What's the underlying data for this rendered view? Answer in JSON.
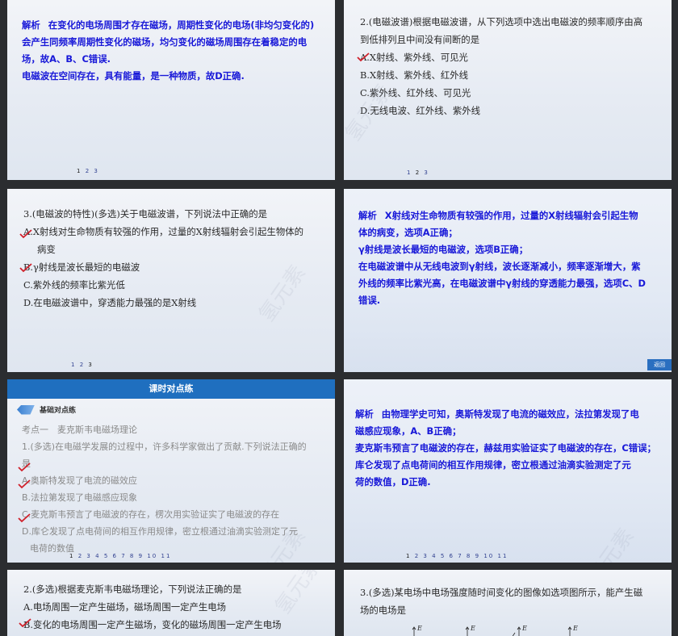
{
  "watermark": "氢元素",
  "slide1": {
    "tag": "解析",
    "lines": [
      "在变化的电场周围才存在磁场，周期性变化的电场(非均匀变化的)",
      "会产生同频率周期性变化的磁场，均匀变化的磁场周围存在着稳定的电",
      "场，故A、B、C错误.",
      "电磁波在空间存在，具有能量，是一种物质，故D正确."
    ],
    "pager": [
      "1",
      "2",
      "3"
    ],
    "pager_current": "1"
  },
  "slide2": {
    "stem": [
      "2.(电磁波谱)根据电磁波谱，从下列选项中选出电磁波的频率顺序由高",
      "到低排列且中间没有间断的是"
    ],
    "options": [
      "A.X射线、紫外线、可见光",
      "B.X射线、紫外线、红外线",
      "C.紫外线、红外线、可见光",
      "D.无线电波、红外线、紫外线"
    ],
    "pager": [
      "1",
      "2",
      "3"
    ],
    "pager_current": "2"
  },
  "slide3": {
    "stem": "3.(电磁波的特性)(多选)关于电磁波谱，下列说法中正确的是",
    "options": [
      "A.X射线对生命物质有较强的作用，过量的X射线辐射会引起生物体的",
      "病变",
      "B.γ射线是波长最短的电磁波",
      "C.紫外线的频率比紫光低",
      "D.在电磁波谱中，穿透能力最强的是X射线"
    ],
    "pager": [
      "1",
      "2",
      "3"
    ],
    "pager_current": "3"
  },
  "slide4": {
    "tag": "解析",
    "lines": [
      "X射线对生命物质有较强的作用，过量的X射线辐射会引起生物",
      "体的病变，选项A正确；",
      "γ射线是波长最短的电磁波，选项B正确；",
      "在电磁波谱中从无线电波到γ射线，波长逐渐减小，频率逐渐增大，紫",
      "外线的频率比紫光高，在电磁波谱中γ射线的穿透能力最强，选项C、D",
      "错误."
    ],
    "back_label": "返回"
  },
  "slide5": {
    "header": "课时对点练",
    "section": "基础对点练",
    "topic": "考点一　麦克斯韦电磁场理论",
    "stem": [
      "1.(多选)在电磁学发展的过程中，许多科学家做出了贡献.下列说法正确的",
      "是"
    ],
    "options": [
      "A.奥斯特发现了电流的磁效应",
      "B.法拉第发现了电磁感应现象",
      "C.麦克斯韦预言了电磁波的存在，楞次用实验证实了电磁波的存在",
      "D.库仑发现了点电荷间的相互作用规律，密立根通过油滴实验测定了元",
      "电荷的数值"
    ],
    "pager": [
      "1",
      "2",
      "3",
      "4",
      "5",
      "6",
      "7",
      "8",
      "9",
      "10",
      "11"
    ],
    "pager_current": "1"
  },
  "slide6": {
    "tag": "解析",
    "lines": [
      "由物理学史可知，奥斯特发现了电流的磁效应，法拉第发现了电",
      "磁感应现象，A、B正确；",
      "麦克斯韦预言了电磁波的存在，赫兹用实验证实了电磁波的存在，C错误；",
      "库仑发现了点电荷间的相互作用规律，密立根通过油滴实验测定了元",
      "荷的数值，D正确."
    ],
    "pager": [
      "1",
      "2",
      "3",
      "4",
      "5",
      "6",
      "7",
      "8",
      "9",
      "10",
      "11"
    ],
    "pager_current": "1"
  },
  "slide7": {
    "stem": "2.(多选)根据麦克斯韦电磁场理论，下列说法正确的是",
    "options": [
      "A.电场周围一定产生磁场，磁场周围一定产生电场",
      "B.变化的电场周围一定产生磁场，变化的磁场周围一定产生电场"
    ]
  },
  "slide8": {
    "stem": [
      "3.(多选)某电场中电场强度随时间变化的图像如选项图所示，能产生磁",
      "场的电场是"
    ],
    "axis_label": "E"
  }
}
